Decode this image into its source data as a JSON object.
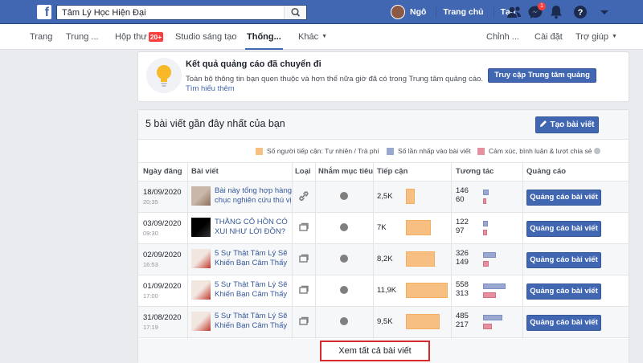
{
  "topbar": {
    "search_value": "Tâm Lý Học Hiện Đại",
    "user_name": "Ngô",
    "home_label": "Trang chủ",
    "create_label": "Tạo",
    "messages_badge": "1",
    "brand_color": "#4267b2"
  },
  "subnav": {
    "items": [
      "Trang",
      "Trung ...",
      "Hộp thư",
      "Studio sáng tạo",
      "Thống...",
      "Khác",
      "Chỉnh ...",
      "Cài đặt",
      "Trợ giúp"
    ],
    "inbox_badge": "20+",
    "active_index": 4
  },
  "ad_card": {
    "title": "Kết quả quảng cáo đã chuyển đi",
    "description": "Toàn bộ thông tin bạn quen thuộc và hơn thế nữa giờ đã có trong Trung tâm quảng cáo.",
    "link": "Tìm hiểu thêm",
    "button": "Truy cập Trung tâm quảng cáo"
  },
  "posts_card": {
    "title": "5 bài viết gần đây nhất của bạn",
    "create_button": "Tạo bài viết",
    "legend": [
      "Số người tiếp cận: Tự nhiên / Trả phí",
      "Số lần nhấp vào bài viết",
      "Cảm xúc, bình luận & lượt chia sẻ"
    ],
    "legend_colors": [
      "#f7c082",
      "#9aa7d1",
      "#e4909e"
    ],
    "headers": [
      "Ngày đăng",
      "Bài viết",
      "Loại",
      "Nhắm mục tiêu",
      "Tiếp cận",
      "Tương tác",
      "Quảng cáo"
    ],
    "boost_label": "Quảng cáo bài viết",
    "see_all": "Xem tất cả bài viết",
    "rows": [
      {
        "date": "18/09/2020",
        "time": "20:35",
        "text": "Bài này tổng hợp hàng chục nghiên cứu thú vị",
        "type": "link",
        "reach": "2,5K",
        "reach_value": 2500,
        "clicks": "146",
        "reactions": "60",
        "clicks_value": 146,
        "reactions_value": 60
      },
      {
        "date": "03/09/2020",
        "time": "09:30",
        "text": "THẰNG CÔ HỒN CÓ XUI NHƯ LỜI ĐỒN?",
        "type": "album",
        "reach": "7K",
        "reach_value": 7000,
        "clicks": "122",
        "reactions": "97",
        "clicks_value": 122,
        "reactions_value": 97
      },
      {
        "date": "02/09/2020",
        "time": "16:53",
        "text": "5 Sự Thật Tâm Lý Sẽ Khiến Bạn Câm Thấy",
        "type": "album",
        "reach": "8,2K",
        "reach_value": 8200,
        "clicks": "326",
        "reactions": "149",
        "clicks_value": 326,
        "reactions_value": 149
      },
      {
        "date": "01/09/2020",
        "time": "17:00",
        "text": "5 Sự Thật Tâm Lý Sẽ Khiến Bạn Câm Thấy",
        "type": "album",
        "reach": "11,9K",
        "reach_value": 11900,
        "clicks": "558",
        "reactions": "313",
        "clicks_value": 558,
        "reactions_value": 313
      },
      {
        "date": "31/08/2020",
        "time": "17:19",
        "text": "5 Sự Thật Tâm Lý Sẽ Khiến Bạn Câm Thấy",
        "type": "album",
        "reach": "9,5K",
        "reach_value": 9500,
        "clicks": "485",
        "reactions": "217",
        "clicks_value": 485,
        "reactions_value": 217
      }
    ]
  }
}
